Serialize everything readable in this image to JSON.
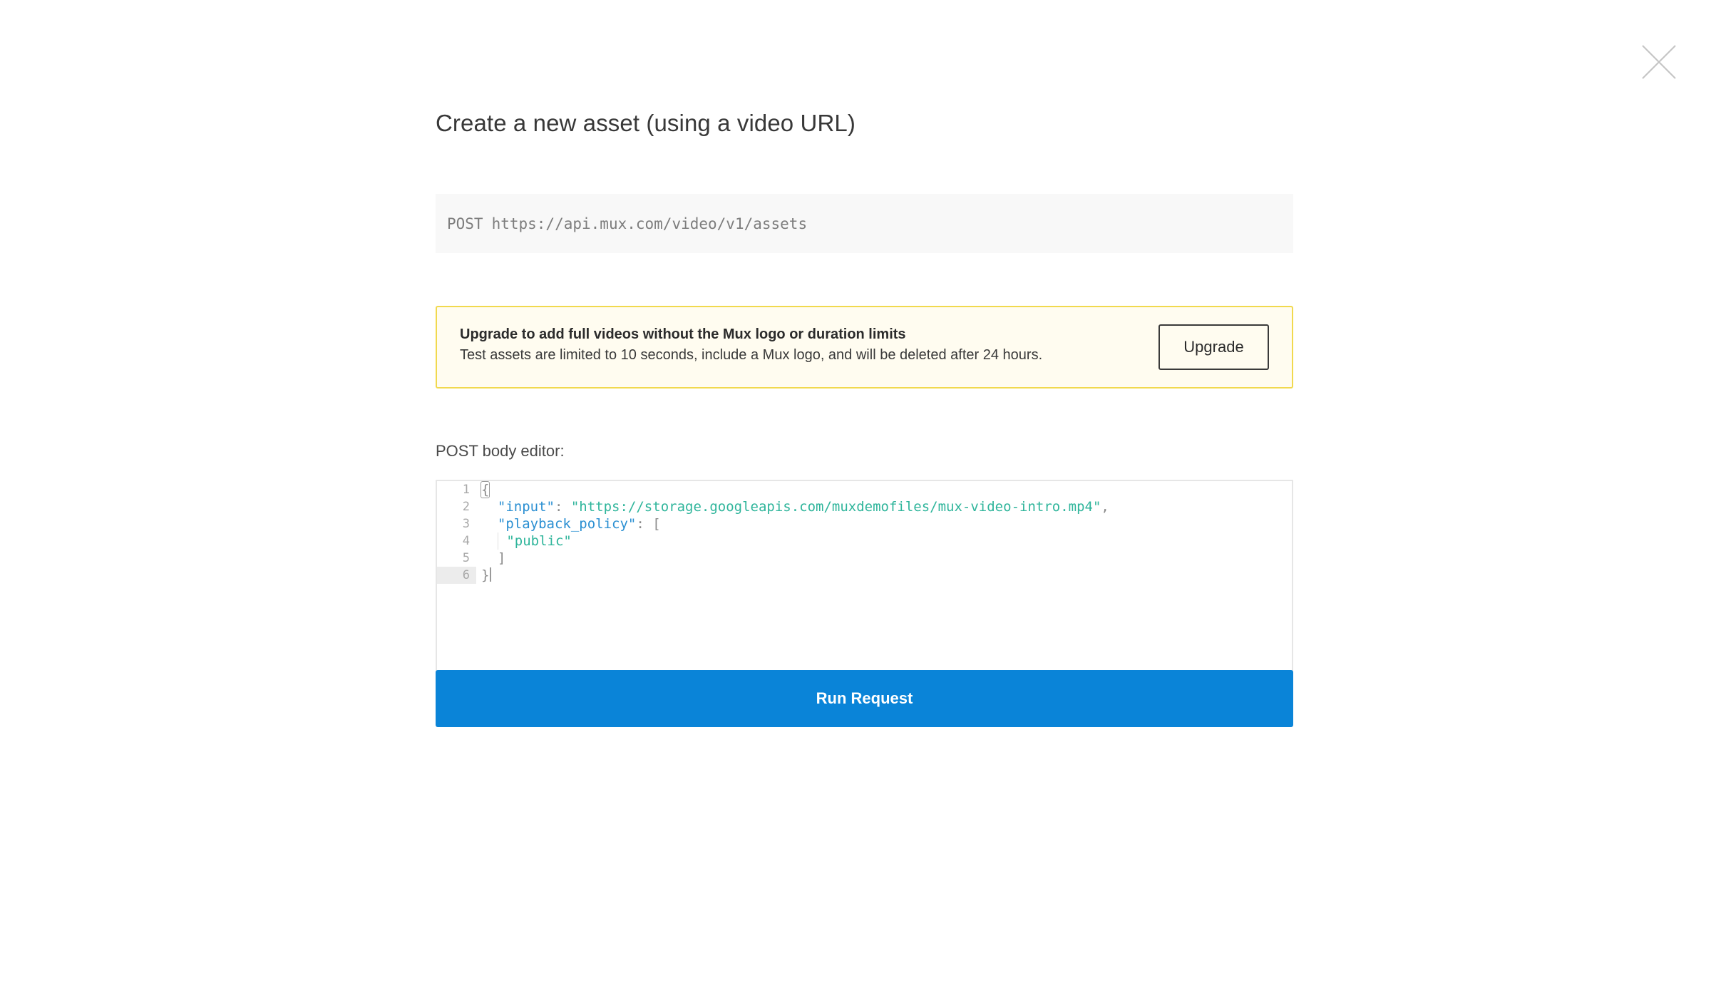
{
  "modal": {
    "title": "Create a new asset (using a video URL)",
    "close_icon": "close-icon"
  },
  "endpoint": {
    "method": "POST",
    "url": "https://api.mux.com/video/v1/assets"
  },
  "upgrade_banner": {
    "title": "Upgrade to add full videos without the Mux logo or duration limits",
    "text": "Test assets are limited to 10 seconds, include a Mux logo, and will be deleted after 24 hours.",
    "button_label": "Upgrade"
  },
  "editor": {
    "label": "POST body editor:",
    "line_numbers": [
      "1",
      "2",
      "3",
      "4",
      "5",
      "6"
    ],
    "active_line": 6,
    "lines": {
      "l1": {
        "brace": "{"
      },
      "l2": {
        "key": "\"input\"",
        "colon": ": ",
        "value": "\"https://storage.googleapis.com/muxdemofiles/mux-video-intro.mp4\"",
        "trail": ","
      },
      "l3": {
        "key": "\"playback_policy\"",
        "colon": ": ",
        "open": "["
      },
      "l4": {
        "value": "\"public\""
      },
      "l5": {
        "close": "]"
      },
      "l6": {
        "brace": "}"
      }
    }
  },
  "actions": {
    "run_label": "Run Request"
  },
  "colors": {
    "primary": "#0a84d8",
    "banner_bg": "#fffcf0",
    "banner_border": "#f1d94e",
    "json_key": "#2a8fd2",
    "json_string": "#2fb59b"
  }
}
